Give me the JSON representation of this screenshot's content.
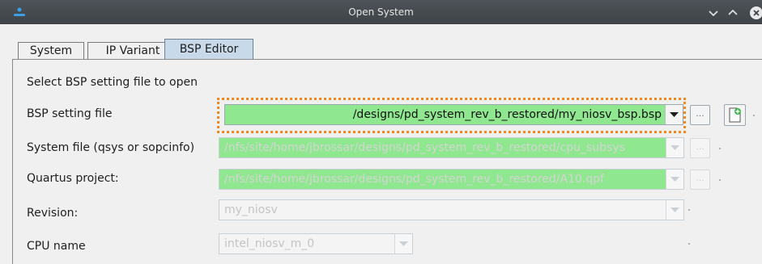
{
  "window": {
    "title": "Open System",
    "icons": {
      "app": "app-logo-icon",
      "minimize": "chevron-down-icon",
      "maximize": "chevron-up-icon",
      "close": "close-icon"
    }
  },
  "tabs": [
    {
      "label": "System",
      "active": false
    },
    {
      "label": "IP Variant",
      "active": false
    },
    {
      "label": "BSP Editor",
      "active": true
    }
  ],
  "form": {
    "heading": "Select BSP setting file to open",
    "bsp_setting_file": {
      "label": "BSP setting file",
      "value": "/designs/pd_system_rev_b_restored/my_niosv_bsp.bsp"
    },
    "system_file": {
      "label": "System file (qsys or sopcinfo)",
      "value": "/nfs/site/home/jbrossar/designs/pd_system_rev_b_restored/cpu_subsys"
    },
    "quartus_project": {
      "label": "Quartus project:",
      "value": "/nfs/site/home/jbrossar/designs/pd_system_rev_b_restored/A10.qpf"
    },
    "revision": {
      "label": "Revision:",
      "value": "my_niosv"
    },
    "cpu_name": {
      "label": "CPU name",
      "value": "intel_niosv_m_0"
    },
    "browse_label": "..."
  },
  "colors": {
    "accent_focus": "#f08a1e",
    "field_valid": "#8fe88f",
    "active_tab": "#c8d9ea",
    "titlebar": "#3e4347"
  }
}
